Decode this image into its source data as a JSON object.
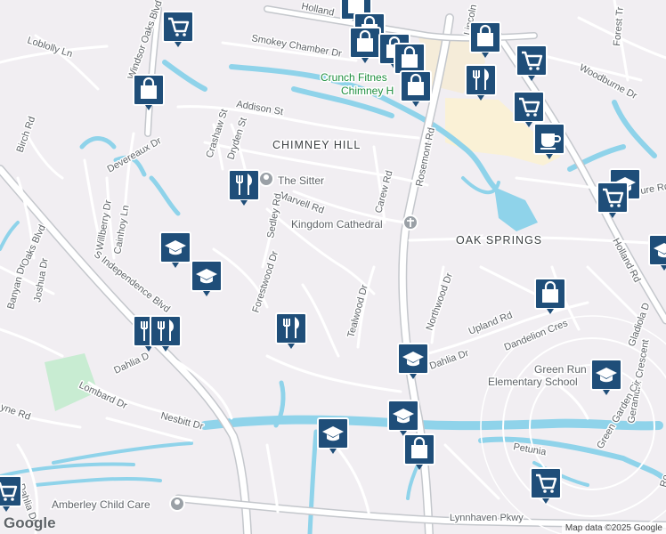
{
  "street_labels": [
    {
      "text": "Holland",
      "key": "holland-top"
    },
    {
      "text": "Loblolly Ln",
      "key": "loblolly"
    },
    {
      "text": "Smokey Chamber Dr",
      "key": "smokey"
    },
    {
      "text": "Windsor Oaks Blvd",
      "key": "windsor"
    },
    {
      "text": "Addison St",
      "key": "addison"
    },
    {
      "text": "Birch Rd",
      "key": "birch"
    },
    {
      "text": "Crashaw St",
      "key": "crashaw"
    },
    {
      "text": "Dryden St",
      "key": "dryden"
    },
    {
      "text": "Devereaux Dr",
      "key": "devereaux"
    },
    {
      "text": "Marvell Rd",
      "key": "marvell"
    },
    {
      "text": "Carew Rd",
      "key": "carew"
    },
    {
      "text": "Rosemont Rd",
      "key": "rosemont"
    },
    {
      "text": "Lincoln",
      "key": "lincoln"
    },
    {
      "text": "Woodburne Dr",
      "key": "woodburne"
    },
    {
      "text": "Forest Tr",
      "key": "forest"
    },
    {
      "text": "Holland Rd",
      "key": "holland-rd"
    },
    {
      "text": "Sedley Rd",
      "key": "sedley"
    },
    {
      "text": "Willberry Dr",
      "key": "willberry"
    },
    {
      "text": "Cainhoy Ln",
      "key": "cainhoy"
    },
    {
      "text": "Oaks Blvd",
      "key": "oaks"
    },
    {
      "text": "Banyan Dr",
      "key": "banyan"
    },
    {
      "text": "Joshua Dr",
      "key": "joshua"
    },
    {
      "text": "S Independence Blvd",
      "key": "sindep"
    },
    {
      "text": "Forestwood Dr",
      "key": "forestwood"
    },
    {
      "text": "Tealwood Dr",
      "key": "tealwood"
    },
    {
      "text": "Northwood Dr",
      "key": "northwood"
    },
    {
      "text": "Upland Rd",
      "key": "upland"
    },
    {
      "text": "Dandelion Cres",
      "key": "dandelion"
    },
    {
      "text": "Gladiola D",
      "key": "gladiola"
    },
    {
      "text": "Geranium Crescent",
      "key": "geranium"
    },
    {
      "text": "Dahlia Dr",
      "key": "dahlia-e"
    },
    {
      "text": "Dahlia D",
      "key": "dahlia-w"
    },
    {
      "text": "Lombard Dr",
      "key": "lombard"
    },
    {
      "text": "Nesbitt Dr",
      "key": "nesbitt"
    },
    {
      "text": "yne Rd",
      "key": "yne"
    },
    {
      "text": "Green Garden Cir",
      "key": "greengarden"
    },
    {
      "text": "Petunia",
      "key": "petunia"
    },
    {
      "text": "Lynnhaven Pkwy",
      "key": "lynnhaven"
    },
    {
      "text": "Dahlia Dr",
      "key": "dahlia-sw"
    },
    {
      "text": "ure Rd",
      "key": "ure"
    },
    {
      "text": "Ro",
      "key": "ro"
    }
  ],
  "area_labels": {
    "chimney_hill": "CHIMNEY HILL",
    "oak_springs": "OAK SPRINGS"
  },
  "poi_labels": {
    "crunch": "Crunch Fitnes",
    "chimney_h": "Chimney H",
    "sitter": "The Sitter",
    "kingdom": "Kingdom Cathedral",
    "green_run_1": "Green Run",
    "green_run_2": "Elementary School",
    "amberley": "Amberley Child Care"
  },
  "map_markers": [
    {
      "icon": "shopping-cart-icon"
    },
    {
      "icon": "shopping-bag-icon"
    },
    {
      "icon": "shopping-bag-icon"
    },
    {
      "icon": "shopping-bag-icon"
    },
    {
      "icon": "shopping-bag-icon"
    },
    {
      "icon": "shopping-bag-icon"
    },
    {
      "icon": "shopping-bag-icon"
    },
    {
      "icon": "restaurant-icon"
    },
    {
      "icon": "shopping-cart-icon"
    },
    {
      "icon": "shopping-cart-icon"
    },
    {
      "icon": "coffee-icon"
    },
    {
      "icon": "shopping-bag-icon"
    },
    {
      "icon": "restaurant-icon"
    },
    {
      "icon": "school-icon"
    },
    {
      "icon": "school-icon"
    },
    {
      "icon": "restaurant-icon"
    },
    {
      "icon": "restaurant-icon"
    },
    {
      "icon": "school-icon"
    },
    {
      "icon": "shopping-cart-icon"
    },
    {
      "icon": "school-icon"
    },
    {
      "icon": "shopping-bag-icon"
    },
    {
      "icon": "school-icon"
    },
    {
      "icon": "school-icon"
    },
    {
      "icon": "school-icon"
    },
    {
      "icon": "shopping-bag-icon"
    },
    {
      "icon": "shopping-cart-icon"
    },
    {
      "icon": "shopping-cart-icon"
    },
    {
      "icon": "school-icon"
    }
  ],
  "branding": {
    "logo": "Google",
    "attribution": "Map data ©2025 Google"
  },
  "colors": {
    "land": "#f1eef2",
    "water": "#8fd3ea",
    "park": "#c8ecd2",
    "commercial": "#faf1d6",
    "marker": "#1f4e79"
  }
}
